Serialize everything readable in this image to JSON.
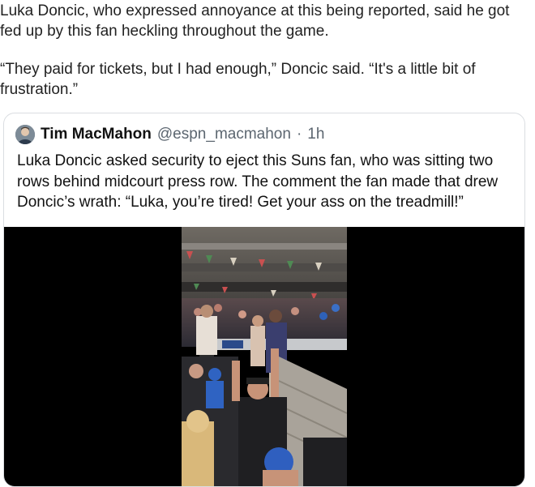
{
  "article": {
    "paragraph1": "Luka Doncic, who expressed annoyance at this being reported, said he got fed up by this fan heckling throughout the game.",
    "paragraph2": "“They paid for tickets, but I had enough,” Doncic said. “It's a little bit of frustration.”"
  },
  "tweet": {
    "author_name": "Tim MacMahon",
    "handle": "@espn_macmahon",
    "separator": "·",
    "time": "1h",
    "text": "Luka Doncic asked security to eject this Suns fan, who was sitting two rows behind midcourt press row. The comment the fan made that drew Doncic’s wrath: “Luka, you’re tired! Get your ass on the treadmill!”",
    "avatar_icon": "user-avatar",
    "media_icon": "video-thumbnail"
  },
  "colors": {
    "card_border": "#dadde1",
    "secondary_text": "#5c6670",
    "media_background": "#000000"
  }
}
